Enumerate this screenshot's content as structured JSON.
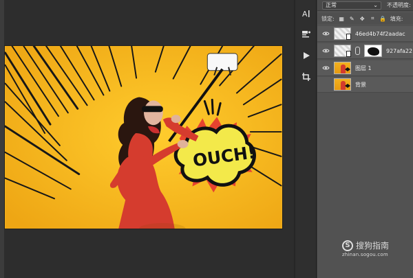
{
  "toolbar": {
    "icons": [
      "character-icon",
      "paragraph-icon",
      "play-icon",
      "crop-icon"
    ]
  },
  "panel": {
    "blend_mode": "正常",
    "opacity_label": "不透明度:",
    "lock_label": "锁定:",
    "fill_label": "填充:",
    "layers": [
      {
        "name": "46ed4b74f2aadac",
        "visible": true,
        "thumbnail": "checker-smart"
      },
      {
        "name": "927afa22",
        "visible": true,
        "thumbnail": "checker-mask"
      },
      {
        "name": "图层 1",
        "visible": true,
        "thumbnail": "orange-photo"
      },
      {
        "name": "背景",
        "visible": false,
        "thumbnail": "orange-photo"
      }
    ]
  },
  "canvas": {
    "speech_text": "OUCH!"
  },
  "watermark": {
    "brand": "搜狗指南",
    "url": "zhinan.sogou.com"
  },
  "colors": {
    "canvas_bg": "#f4b521",
    "dress_red": "#d53c2e",
    "speech_yellow": "#f3e94a",
    "burst_red": "#e7432f"
  }
}
